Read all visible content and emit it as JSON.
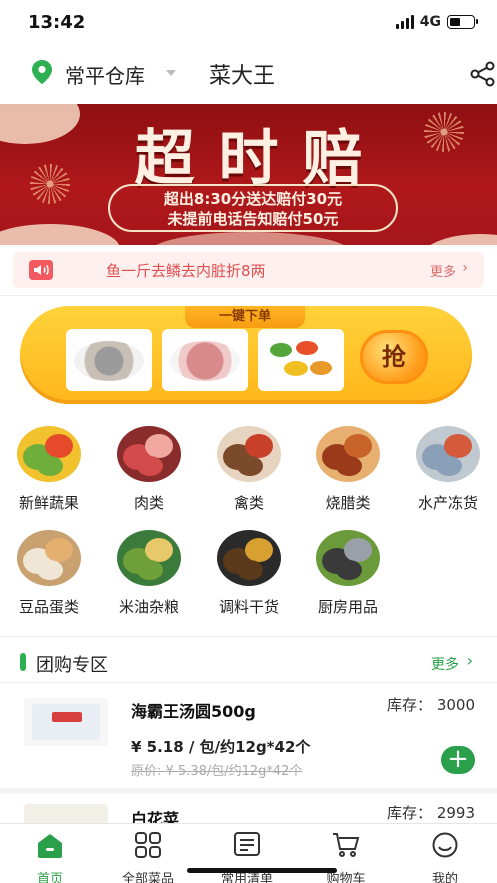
{
  "status": {
    "time": "13:42",
    "network": "4G"
  },
  "header": {
    "warehouse": "常平仓库",
    "store_name": "菜大王"
  },
  "banner": {
    "title": "超时赔",
    "line1": "超出8:30分送达赔付30元",
    "line2": "未提前电话告知赔付50元"
  },
  "notice": {
    "text": "鱼一斤去鳞去内脏折8两",
    "more": "更多"
  },
  "quick_order": {
    "tag": "一键下单",
    "grab": "抢"
  },
  "categories": [
    {
      "label": "新鲜蔬果",
      "icon": "vegetables-icon"
    },
    {
      "label": "肉类",
      "icon": "meat-icon"
    },
    {
      "label": "禽类",
      "icon": "poultry-icon"
    },
    {
      "label": "烧腊类",
      "icon": "roast-meat-icon"
    },
    {
      "label": "水产冻货",
      "icon": "seafood-icon"
    },
    {
      "label": "豆品蛋类",
      "icon": "eggs-icon"
    },
    {
      "label": "米油杂粮",
      "icon": "rice-oil-icon"
    },
    {
      "label": "调料干货",
      "icon": "seasoning-icon"
    },
    {
      "label": "厨房用品",
      "icon": "kitchenware-icon"
    }
  ],
  "group_section": {
    "title": "团购专区",
    "more": "更多"
  },
  "products": [
    {
      "name": "海霸王汤圆500g",
      "stock": "库存：  3000",
      "price": "¥ 5.18 / 包/约12g*42个",
      "original": "原价: ¥ 5.38/包/约12g*42个"
    },
    {
      "name": "白花菜",
      "stock": "库存：  2993"
    }
  ],
  "tabbar": [
    {
      "label": "首页",
      "icon": "home-icon",
      "active": true
    },
    {
      "label": "全部菜品",
      "icon": "grid-icon"
    },
    {
      "label": "常用清单",
      "icon": "list-icon"
    },
    {
      "label": "购物车",
      "icon": "cart-icon"
    },
    {
      "label": "我的",
      "icon": "profile-icon"
    }
  ],
  "colors": {
    "brand_green": "#2aa04a",
    "banner_red": "#a5161a",
    "notice_red": "#e05050"
  }
}
